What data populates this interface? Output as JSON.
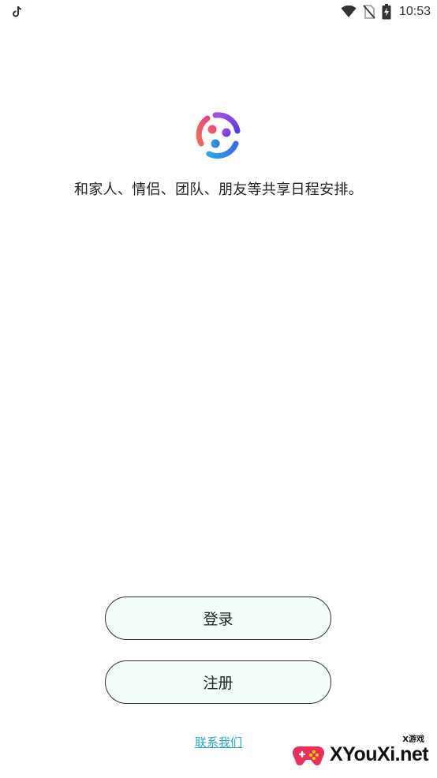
{
  "status_bar": {
    "time": "10:53",
    "icons": [
      "tiktok-icon",
      "wifi-icon",
      "no-sim-icon",
      "battery-charging-icon"
    ]
  },
  "app": {
    "logo_icon": "people-circle-logo-icon",
    "tagline": "和家人、情侣、团队、朋友等共享日程安排。"
  },
  "actions": {
    "login_label": "登录",
    "register_label": "注册",
    "contact_label": "联系我们"
  },
  "watermark": {
    "text": "XYouXi.net",
    "sub": "X游戏"
  },
  "colors": {
    "button_fill": "#f2fcfb",
    "button_border": "#333333",
    "link": "#29a8b8",
    "logo_purple": "#7b3fe4",
    "logo_pink": "#e8437f",
    "logo_cyan": "#1fb6e0"
  }
}
